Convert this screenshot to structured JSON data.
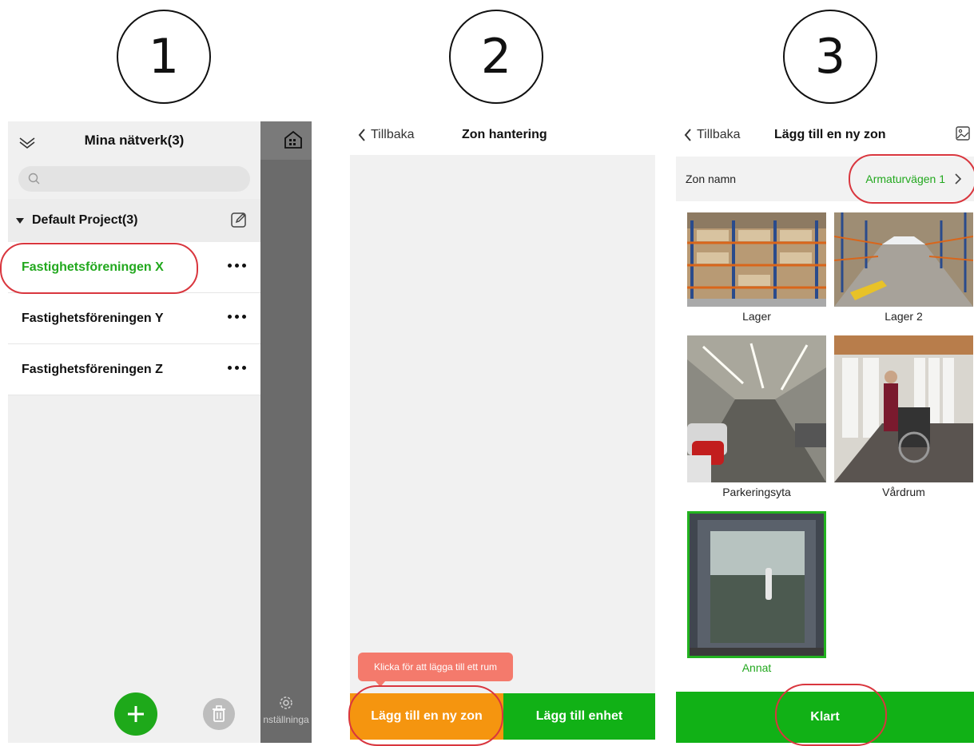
{
  "steps": [
    "1",
    "2",
    "3"
  ],
  "panel1": {
    "title": "Mina nätverk(3)",
    "project": "Default Project(3)",
    "networks": [
      "Fastighetsföreningen X",
      "Fastighetsföreningen Y",
      "Fastighetsföreningen Z"
    ],
    "settings_label": "nställninga"
  },
  "panel2": {
    "back": "Tillbaka",
    "title": "Zon hantering",
    "tooltip": "Klicka för att lägga till ett rum",
    "add_zone": "Lägg till en ny zon",
    "add_device": "Lägg till enhet"
  },
  "panel3": {
    "back": "Tillbaka",
    "title": "Lägg till en ny zon",
    "zone_name_label": "Zon namn",
    "zone_name_value": "Armaturvägen 1",
    "tiles": [
      "Lager",
      "Lager 2",
      "Parkeringsyta",
      "Vårdrum",
      "Annat"
    ],
    "selected": "Annat",
    "done": "Klart"
  },
  "colors": {
    "green": "#22a81e",
    "orange": "#f5950f",
    "highlight": "#d9363e",
    "tooltip": "#f47a6c"
  }
}
